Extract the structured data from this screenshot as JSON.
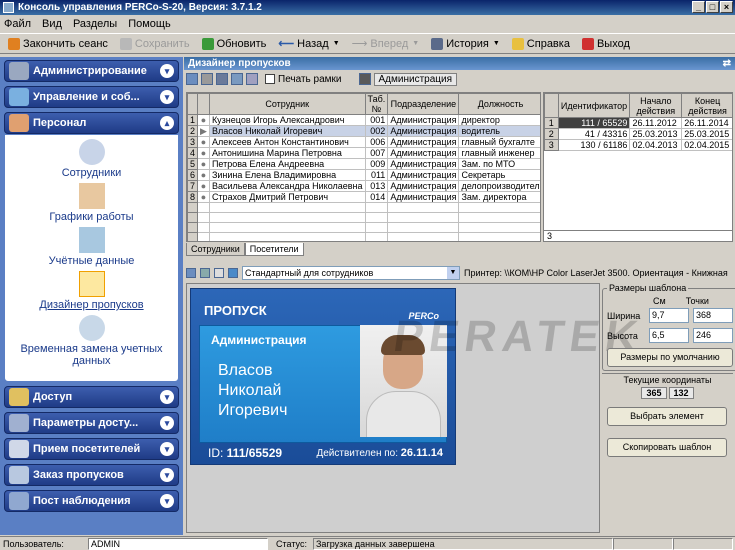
{
  "window": {
    "title": "Консоль управления PERCo-S-20, Версия: 3.7.1.2"
  },
  "menu": [
    "Файл",
    "Вид",
    "Разделы",
    "Помощь"
  ],
  "toolbar": {
    "end_session": "Закончить сеанс",
    "save": "Сохранить",
    "refresh": "Обновить",
    "back": "Назад",
    "forward": "Вперед",
    "history": "История",
    "help": "Справка",
    "exit": "Выход"
  },
  "sidebar": {
    "groups_top": [
      "Администрирование",
      "Управление и соб...",
      "Персонал"
    ],
    "personnel_items": [
      "Сотрудники",
      "Графики работы",
      "Учётные данные",
      "Дизайнер пропусков",
      "Временная замена учетных данных"
    ],
    "groups_bottom": [
      "Доступ",
      "Параметры досту...",
      "Прием посетителей",
      "Заказ пропусков",
      "Пост наблюдения"
    ]
  },
  "main": {
    "title": "Дизайнер пропусков",
    "print_frames_label": "Печать рамки",
    "dept_button": "Администрация"
  },
  "employees": {
    "columns": [
      "Сотрудник",
      "Таб. №",
      "Подразделение",
      "Должность"
    ],
    "rows": [
      [
        "Кузнецов Игорь Александрович",
        "001",
        "Администрация",
        "директор"
      ],
      [
        "Власов Николай Игоревич",
        "002",
        "Администрация",
        "водитель"
      ],
      [
        "Алексеев Антон Константинович",
        "006",
        "Администрация",
        "главный бухгалте"
      ],
      [
        "Антонишина Марина Петровна",
        "007",
        "Администрация",
        "главный инженер"
      ],
      [
        "Петрова Елена Андреевна",
        "009",
        "Администрация",
        "Зам. по МТО"
      ],
      [
        "Зинина Елена Владимировна",
        "011",
        "Администрация",
        "Секретарь"
      ],
      [
        "Васильева Александра Николаевна",
        "013",
        "Администрация",
        "делопроизводител"
      ],
      [
        "Страхов Дмитрий Петрович",
        "014",
        "Администрация",
        "Зам. директора"
      ]
    ],
    "row_numbers": [
      "1",
      "2",
      "3",
      "4",
      "5",
      "6",
      "7",
      "8"
    ]
  },
  "identifiers": {
    "columns": [
      "Идентификатор",
      "Начало действия",
      "Конец действия"
    ],
    "rows": [
      [
        "111 / 65529",
        "26.11.2012",
        "26.11.2014"
      ],
      [
        "41 / 43316",
        "25.03.2013",
        "25.03.2015"
      ],
      [
        "130 / 61186",
        "02.04.2013",
        "02.04.2015"
      ]
    ],
    "row_numbers": [
      "1",
      "2",
      "3"
    ],
    "footer_number": "3"
  },
  "tabs": [
    "Сотрудники",
    "Посетители"
  ],
  "preview": {
    "template": "Стандартный для сотрудников",
    "printer": "Принтер: \\\\КОМ\\HP Color LaserJet 3500. Ориентация - Книжная"
  },
  "card": {
    "title": "ПРОПУСК",
    "logo": "PERCo",
    "department": "Администрация",
    "name_lines": [
      "Власов",
      "Николай",
      "Игоревич"
    ],
    "id_label": "ID: ",
    "id_value": "111/65529",
    "valid_label": "Действителен по: ",
    "valid_value": "26.11.14"
  },
  "watermark": "PERATEK",
  "template_size": {
    "legend": "Размеры шаблона",
    "col_cm": "См",
    "col_points": "Точки",
    "width_label": "Ширина",
    "width_cm": "9,7",
    "width_points": "368",
    "height_label": "Высота",
    "height_cm": "6,5",
    "height_points": "246",
    "default_button": "Размеры по умолчанию"
  },
  "coords": {
    "legend": "Текущие координаты",
    "x": "365",
    "y": "132"
  },
  "buttons": {
    "select_element": "Выбрать элемент",
    "copy_template": "Скопировать шаблон"
  },
  "status": {
    "user_label": "Пользователь:",
    "user": "ADMIN",
    "status_label": "Статус:",
    "status": "Загрузка данных завершена"
  },
  "colors": {
    "sidebar": "#5a7fc4",
    "card": "#2c67b8",
    "card_inner": "#2e9be0"
  }
}
